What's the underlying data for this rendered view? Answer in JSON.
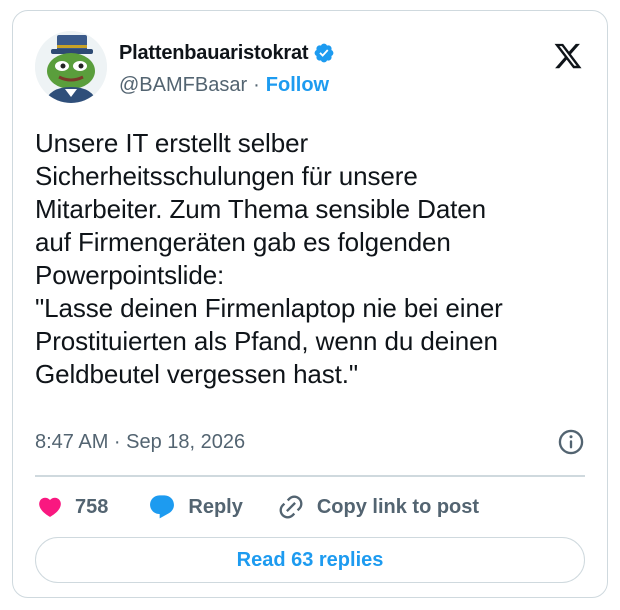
{
  "author": {
    "display_name": "Plattenbauaristokrat",
    "handle": "@BAMFBasar",
    "separator": "·",
    "follow_label": "Follow",
    "verified": true
  },
  "tweet": {
    "text": "Unsere IT erstellt selber\nSicherheitsschulungen für unsere\nMitarbeiter. Zum Thema sensible Daten\nauf Firmengeräten gab es folgenden\nPowerpointslide:\n\"Lasse deinen Firmenlaptop nie bei einer\nProstituierten als Pfand, wenn du deinen\nGeldbeutel vergessen hast.\"",
    "timestamp": "8:47 AM · Sep 18, 2026"
  },
  "actions": {
    "like_count": "758",
    "reply_label": "Reply",
    "copy_label": "Copy link to post"
  },
  "footer": {
    "read_replies_label": "Read 63 replies"
  },
  "icons": {
    "verified": "verified-badge-icon",
    "platform": "x-logo-icon",
    "info": "info-icon",
    "like": "heart-icon",
    "reply": "speech-bubble-icon",
    "copy": "link-icon"
  },
  "colors": {
    "accent": "#1d9bf0",
    "like": "#f91880",
    "text": "#0f1419",
    "secondary": "#536471",
    "border": "#cfd9de"
  }
}
